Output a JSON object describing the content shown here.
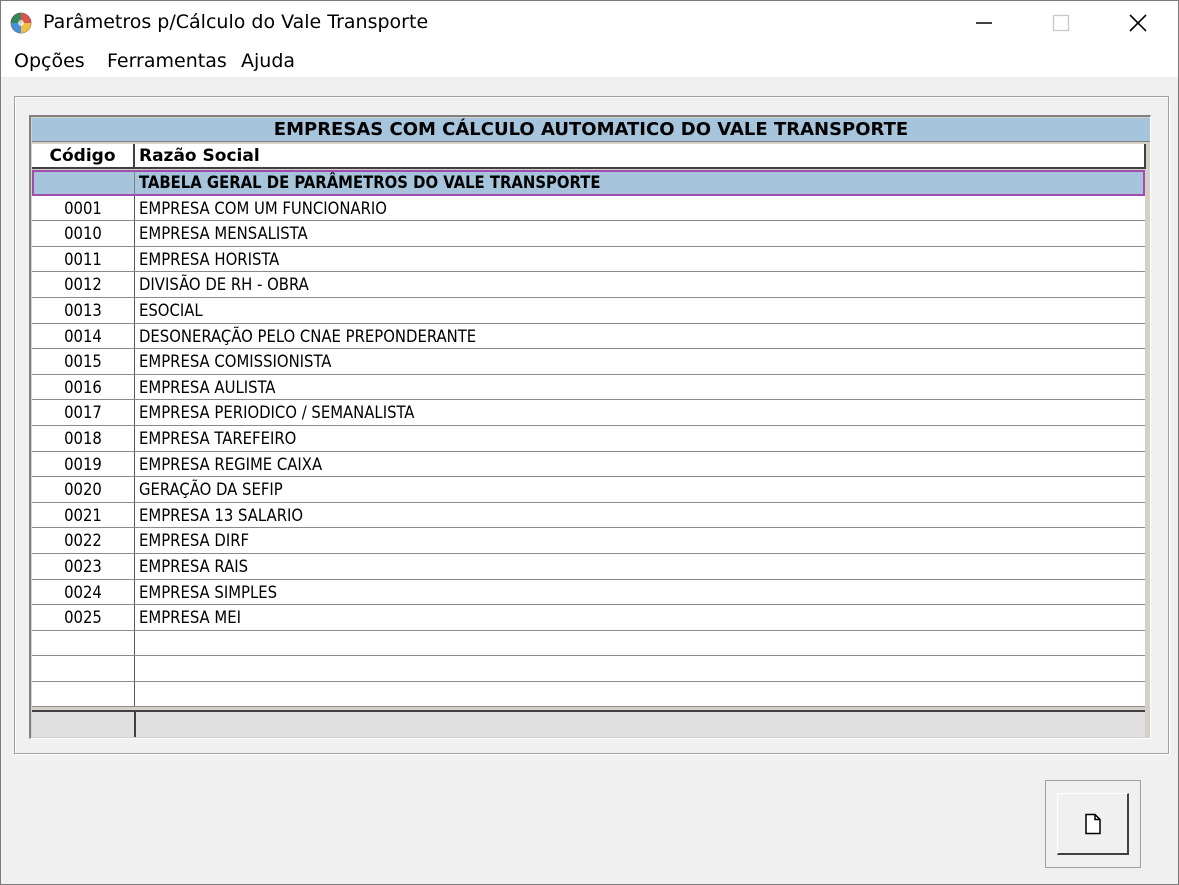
{
  "window": {
    "title": "Parâmetros p/Cálculo do Vale Transporte",
    "icon": "app-globe-icon",
    "controls": [
      "minimize-icon",
      "maximize-icon",
      "close-icon"
    ]
  },
  "menu": {
    "items": [
      "Opções",
      "Ferramentas",
      "Ajuda"
    ]
  },
  "grid": {
    "banner": "EMPRESAS COM CÁLCULO AUTOMATICO DO VALE TRANSPORTE",
    "columns": {
      "code": "Código",
      "name": "Razão Social"
    },
    "rows": [
      {
        "code": "",
        "name": "TABELA GERAL DE PARÂMETROS DO VALE TRANSPORTE",
        "selected": true
      },
      {
        "code": "0001",
        "name": "EMPRESA COM UM FUNCIONARIO"
      },
      {
        "code": "0010",
        "name": "EMPRESA MENSALISTA"
      },
      {
        "code": "0011",
        "name": "EMPRESA HORISTA"
      },
      {
        "code": "0012",
        "name": "DIVISÃO DE RH - OBRA"
      },
      {
        "code": "0013",
        "name": "ESOCIAL"
      },
      {
        "code": "0014",
        "name": "DESONERAÇÃO PELO CNAE PREPONDERANTE"
      },
      {
        "code": "0015",
        "name": "EMPRESA COMISSIONISTA"
      },
      {
        "code": "0016",
        "name": "EMPRESA AULISTA"
      },
      {
        "code": "0017",
        "name": "EMPRESA PERIODICO / SEMANALISTA"
      },
      {
        "code": "0018",
        "name": "EMPRESA TAREFEIRO"
      },
      {
        "code": "0019",
        "name": "EMPRESA REGIME CAIXA"
      },
      {
        "code": "0020",
        "name": "GERAÇÃO DA SEFIP"
      },
      {
        "code": "0021",
        "name": "EMPRESA 13 SALARIO"
      },
      {
        "code": "0022",
        "name": "EMPRESA DIRF"
      },
      {
        "code": "0023",
        "name": "EMPRESA RAIS"
      },
      {
        "code": "0024",
        "name": "EMPRESA SIMPLES"
      },
      {
        "code": "0025",
        "name": "EMPRESA MEI"
      },
      {
        "code": "",
        "name": ""
      },
      {
        "code": "",
        "name": ""
      },
      {
        "code": "",
        "name": ""
      }
    ]
  },
  "actions": {
    "new_button_icon": "new-document-icon"
  },
  "colors": {
    "banner": "#a6c4dc",
    "selection_outline": "#a04cb0"
  }
}
